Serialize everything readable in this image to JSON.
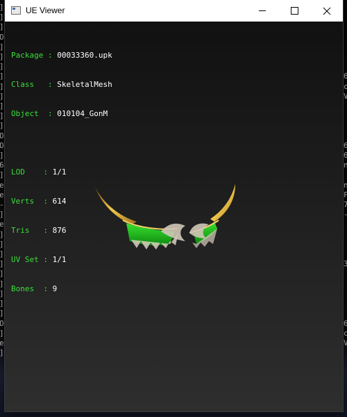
{
  "window": {
    "title": "UE Viewer",
    "buttons": [
      "minimize",
      "maximize",
      "close"
    ]
  },
  "info": {
    "package": {
      "key": "Package",
      "value": "00033360.upk"
    },
    "class": {
      "key": "Class",
      "value": "SkeletalMesh"
    },
    "object": {
      "key": "Object",
      "value": "010104_GonM"
    },
    "lod": {
      "key": "LOD",
      "value": "1/1"
    },
    "verts": {
      "key": "Verts",
      "value": "614"
    },
    "tris": {
      "key": "Tris",
      "value": "876"
    },
    "uvset": {
      "key": "UV Set",
      "value": "1/1"
    },
    "bones": {
      "key": "Bones",
      "value": "9"
    }
  },
  "background": {
    "left_column": [
      "]",
      "]",
      "]",
      "O",
      "]",
      "]",
      "]",
      "]",
      "]",
      "]",
      "]",
      "]",
      "]",
      "O",
      "O",
      "]",
      "6",
      "]",
      "e",
      "e",
      "-",
      "]",
      "e",
      "]",
      "]",
      "]",
      "]",
      "]",
      "]",
      "]",
      "]",
      "]",
      "O",
      "]",
      "e",
      "]"
    ],
    "right_column": [
      "",
      "",
      "",
      "",
      "",
      "",
      "",
      "6",
      "c",
      "V",
      "",
      "",
      "",
      "",
      "6",
      "6",
      "n",
      "",
      "n",
      "F",
      "7",
      "-",
      "",
      "",
      "",
      "",
      "3",
      "",
      "",
      "",
      "",
      "",
      "6",
      "c",
      "V"
    ]
  },
  "colors": {
    "label": "#3adf3a",
    "value": "#ffffff",
    "viewport_top": "#111111",
    "viewport_bottom": "#2e2e2e",
    "mesh_green": "#22c81e",
    "mesh_gold": "#c9a227"
  }
}
